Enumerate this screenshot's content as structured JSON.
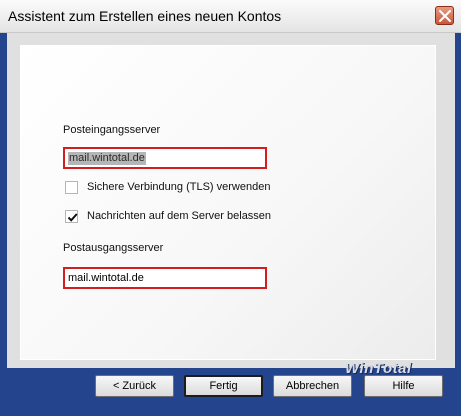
{
  "window": {
    "title": "Assistent zum Erstellen eines neuen Kontos"
  },
  "form": {
    "incoming_label": "Posteingangsserver",
    "incoming_value": "mail.wintotal.de",
    "tls_label": "Sichere Verbindung (TLS) verwenden",
    "tls_checked": false,
    "keep_label": "Nachrichten auf dem Server belassen",
    "keep_checked": true,
    "outgoing_label": "Postausgangsserver",
    "outgoing_value": "mail.wintotal.de"
  },
  "watermark": "WinTotal",
  "buttons": {
    "back": "< Zurück",
    "finish": "Fertig",
    "cancel": "Abbrechen",
    "help": "Hilfe"
  },
  "colors": {
    "window_frame": "#24458e",
    "field_border": "#d41e1e",
    "close_button": "#c9573c"
  }
}
